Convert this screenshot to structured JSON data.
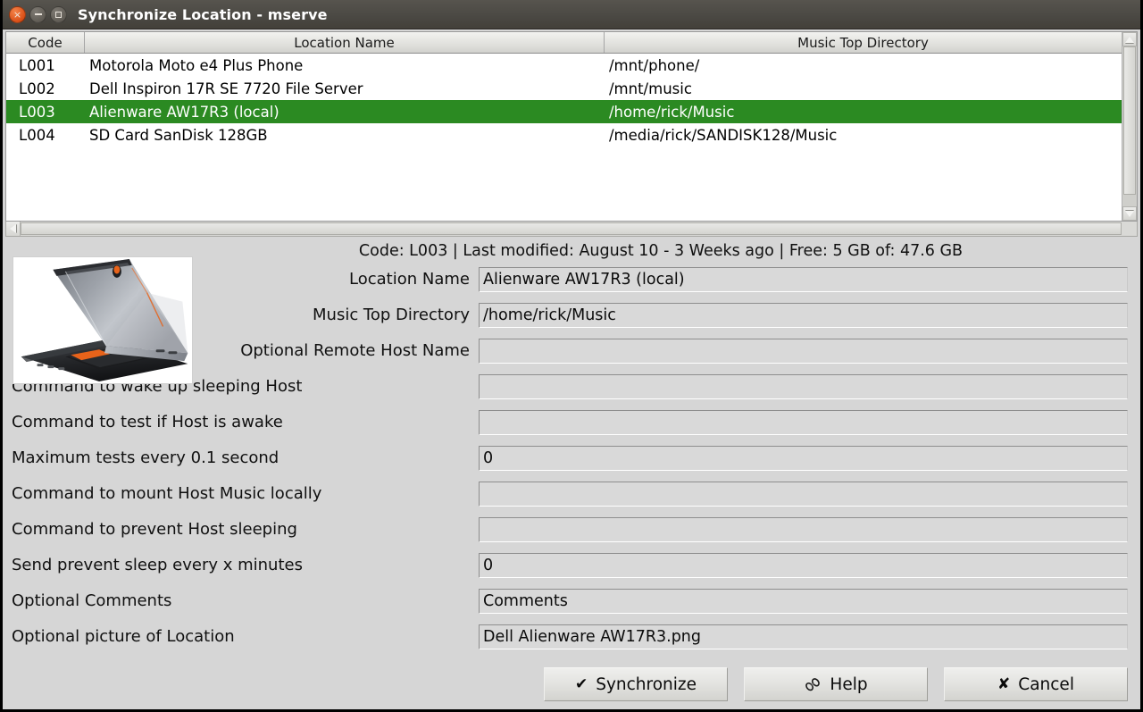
{
  "window": {
    "title": "Synchronize Location - mserve",
    "controls": {
      "close": "×",
      "minimize": "−",
      "maximize": "□"
    }
  },
  "colors": {
    "selection_green": "#2b8a22",
    "titlebar": "#4b4944",
    "window_bg": "#d6d6d6",
    "field_bg": "#d9d9d9",
    "close_button": "#d94f17"
  },
  "table": {
    "columns": [
      "Code",
      "Location Name",
      "Music Top Directory"
    ],
    "rows": [
      {
        "code": "L001",
        "name": "Motorola Moto e4 Plus Phone",
        "dir": "/mnt/phone/",
        "selected": false
      },
      {
        "code": "L002",
        "name": "Dell Inspiron 17R SE 7720 File Server",
        "dir": "/mnt/music",
        "selected": false
      },
      {
        "code": "L003",
        "name": "Alienware AW17R3 (local)",
        "dir": "/home/rick/Music",
        "selected": true
      },
      {
        "code": "L004",
        "name": "SD Card SanDisk 128GB",
        "dir": "/media/rick/SANDISK128/Music",
        "selected": false
      }
    ]
  },
  "info": {
    "line": "Code: L003  | Last modified: August 10 - 3 Weeks ago  | Free: 5 GB of: 47.6 GB"
  },
  "thumbnail": {
    "alt": "Dell Alienware AW17R3 laptop"
  },
  "form": {
    "fields": [
      {
        "label": "Location Name",
        "value": "Alienware AW17R3 (local)",
        "align": "right"
      },
      {
        "label": "Music Top Directory",
        "value": "/home/rick/Music",
        "align": "right"
      },
      {
        "label": "Optional Remote Host Name",
        "value": "",
        "align": "right"
      },
      {
        "label": "Command to wake up sleeping Host",
        "value": "",
        "align": "left"
      },
      {
        "label": "Command to test if Host is awake",
        "value": "",
        "align": "left"
      },
      {
        "label": "Maximum tests every 0.1 second",
        "value": "0",
        "align": "left"
      },
      {
        "label": "Command to mount Host Music locally",
        "value": "",
        "align": "left"
      },
      {
        "label": "Command to prevent Host sleeping",
        "value": "",
        "align": "left"
      },
      {
        "label": "Send prevent sleep every x minutes",
        "value": "0",
        "align": "left"
      },
      {
        "label": "Optional Comments",
        "value": "Comments",
        "align": "left"
      },
      {
        "label": "Optional picture of Location",
        "value": "Dell Alienware AW17R3.png",
        "align": "left"
      }
    ]
  },
  "buttons": [
    {
      "icon": "checkmark-icon",
      "glyph": "✔",
      "label": "Synchronize",
      "name": "synchronize-button"
    },
    {
      "icon": "chain-link-icon",
      "glyph": "",
      "label": "Help",
      "name": "help-button"
    },
    {
      "icon": "x-mark-icon",
      "glyph": "✘",
      "label": "Cancel",
      "name": "cancel-button"
    }
  ]
}
